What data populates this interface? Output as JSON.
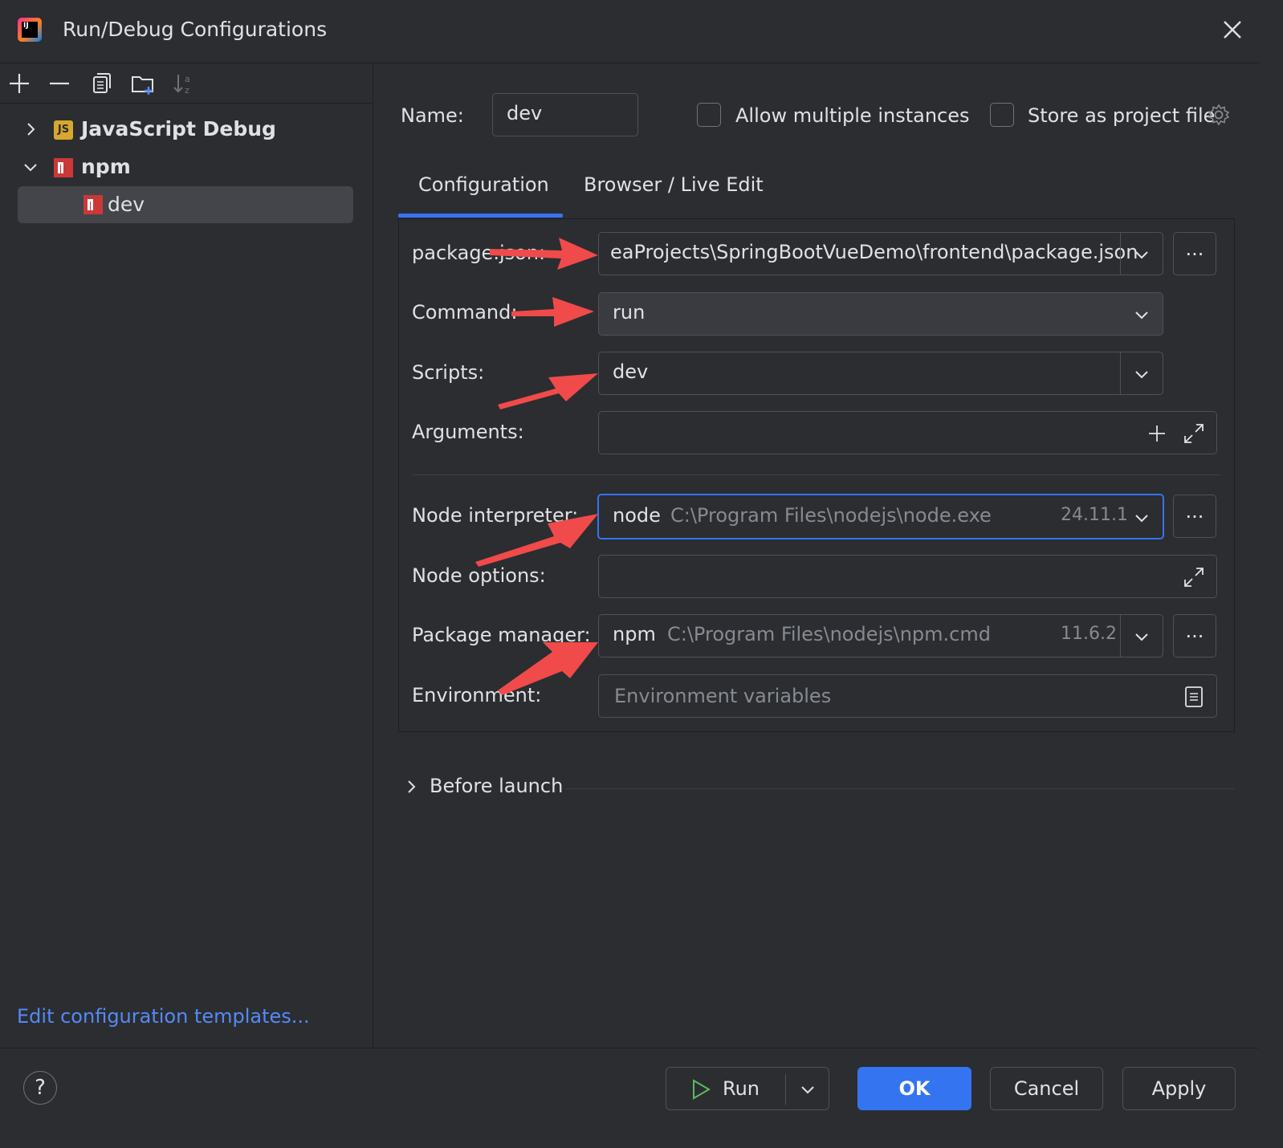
{
  "window": {
    "title": "Run/Debug Configurations",
    "app_icon_text": "IJ"
  },
  "tree": {
    "groups": [
      {
        "label": "JavaScript Debug",
        "icon_text": "JS",
        "expanded": false
      },
      {
        "label": "npm",
        "expanded": true,
        "children": [
          {
            "label": "dev",
            "selected": true
          }
        ]
      }
    ]
  },
  "left_footer": {
    "edit_templates": "Edit configuration templates..."
  },
  "header": {
    "name_label": "Name:",
    "name_value": "dev",
    "allow_multiple": "Allow multiple instances",
    "store_project": "Store as project file"
  },
  "tabs": [
    {
      "label": "Configuration",
      "active": true
    },
    {
      "label": "Browser / Live Edit",
      "active": false
    }
  ],
  "form": {
    "package_json": {
      "label": "package.json:",
      "value": "eaProjects\\SpringBootVueDemo\\frontend\\package.json"
    },
    "command": {
      "label": "Command:",
      "value": "run"
    },
    "scripts": {
      "label": "Scripts:",
      "value": "dev"
    },
    "arguments": {
      "label": "Arguments:",
      "value": ""
    },
    "node_interpreter": {
      "label": "Node interpreter:",
      "name": "node",
      "path": "C:\\Program Files\\nodejs\\node.exe",
      "version": "24.11.1"
    },
    "node_options": {
      "label": "Node options:",
      "value": ""
    },
    "package_manager": {
      "label": "Package manager:",
      "name": "npm",
      "path": "C:\\Program Files\\nodejs\\npm.cmd",
      "version": "11.6.2"
    },
    "environment": {
      "label": "Environment:",
      "placeholder": "Environment variables"
    },
    "browse_label": "..."
  },
  "before_launch": "Before launch",
  "footer": {
    "help": "?",
    "run": "Run",
    "ok": "OK",
    "cancel": "Cancel",
    "apply": "Apply"
  },
  "colors": {
    "accent": "#3574f0",
    "background": "#2b2d30",
    "annotation_arrow": "#f04a4a"
  }
}
